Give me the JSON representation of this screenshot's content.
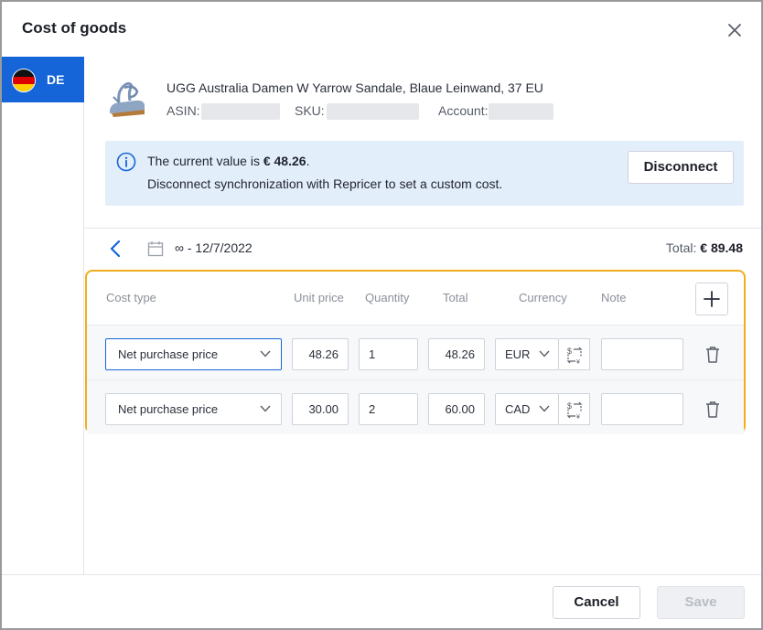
{
  "dialog": {
    "title": "Cost of goods",
    "close_icon": "close-icon"
  },
  "sidebar": {
    "markets": [
      {
        "code": "DE",
        "flag": "germany-flag-icon",
        "selected": true
      }
    ]
  },
  "product": {
    "name": "UGG Australia Damen W Yarrow Sandale, Blaue Leinwand, 37 EU",
    "asin_label": "ASIN:",
    "sku_label": "SKU:",
    "account_label": "Account:"
  },
  "info": {
    "icon": "info-icon",
    "line1_prefix": "The current value is ",
    "line1_value": "€ 48.26",
    "line1_suffix": ".",
    "line2": "Disconnect synchronization with Repricer to set a custom cost.",
    "disconnect_label": "Disconnect"
  },
  "period": {
    "back_icon": "chevron-left-icon",
    "calendar_icon": "calendar-icon",
    "range": "∞ - 12/7/2022",
    "total_label": "Total: ",
    "total_value": "€ 89.48"
  },
  "table": {
    "headers": {
      "cost_type": "Cost type",
      "unit_price": "Unit price",
      "quantity": "Quantity",
      "total": "Total",
      "currency": "Currency",
      "note": "Note"
    },
    "add_icon": "plus-icon",
    "rows": [
      {
        "cost_type": "Net purchase price",
        "unit_price": "48.26",
        "quantity": "1",
        "total": "48.26",
        "currency": "EUR",
        "note": ""
      },
      {
        "cost_type": "Net purchase price",
        "unit_price": "30.00",
        "quantity": "2",
        "total": "60.00",
        "currency": "CAD",
        "note": ""
      }
    ]
  },
  "footer": {
    "cancel_label": "Cancel",
    "save_label": "Save"
  },
  "colors": {
    "accent": "#1565d8",
    "highlight_border": "#f0ad1f",
    "info_bg": "#e3eefb"
  }
}
